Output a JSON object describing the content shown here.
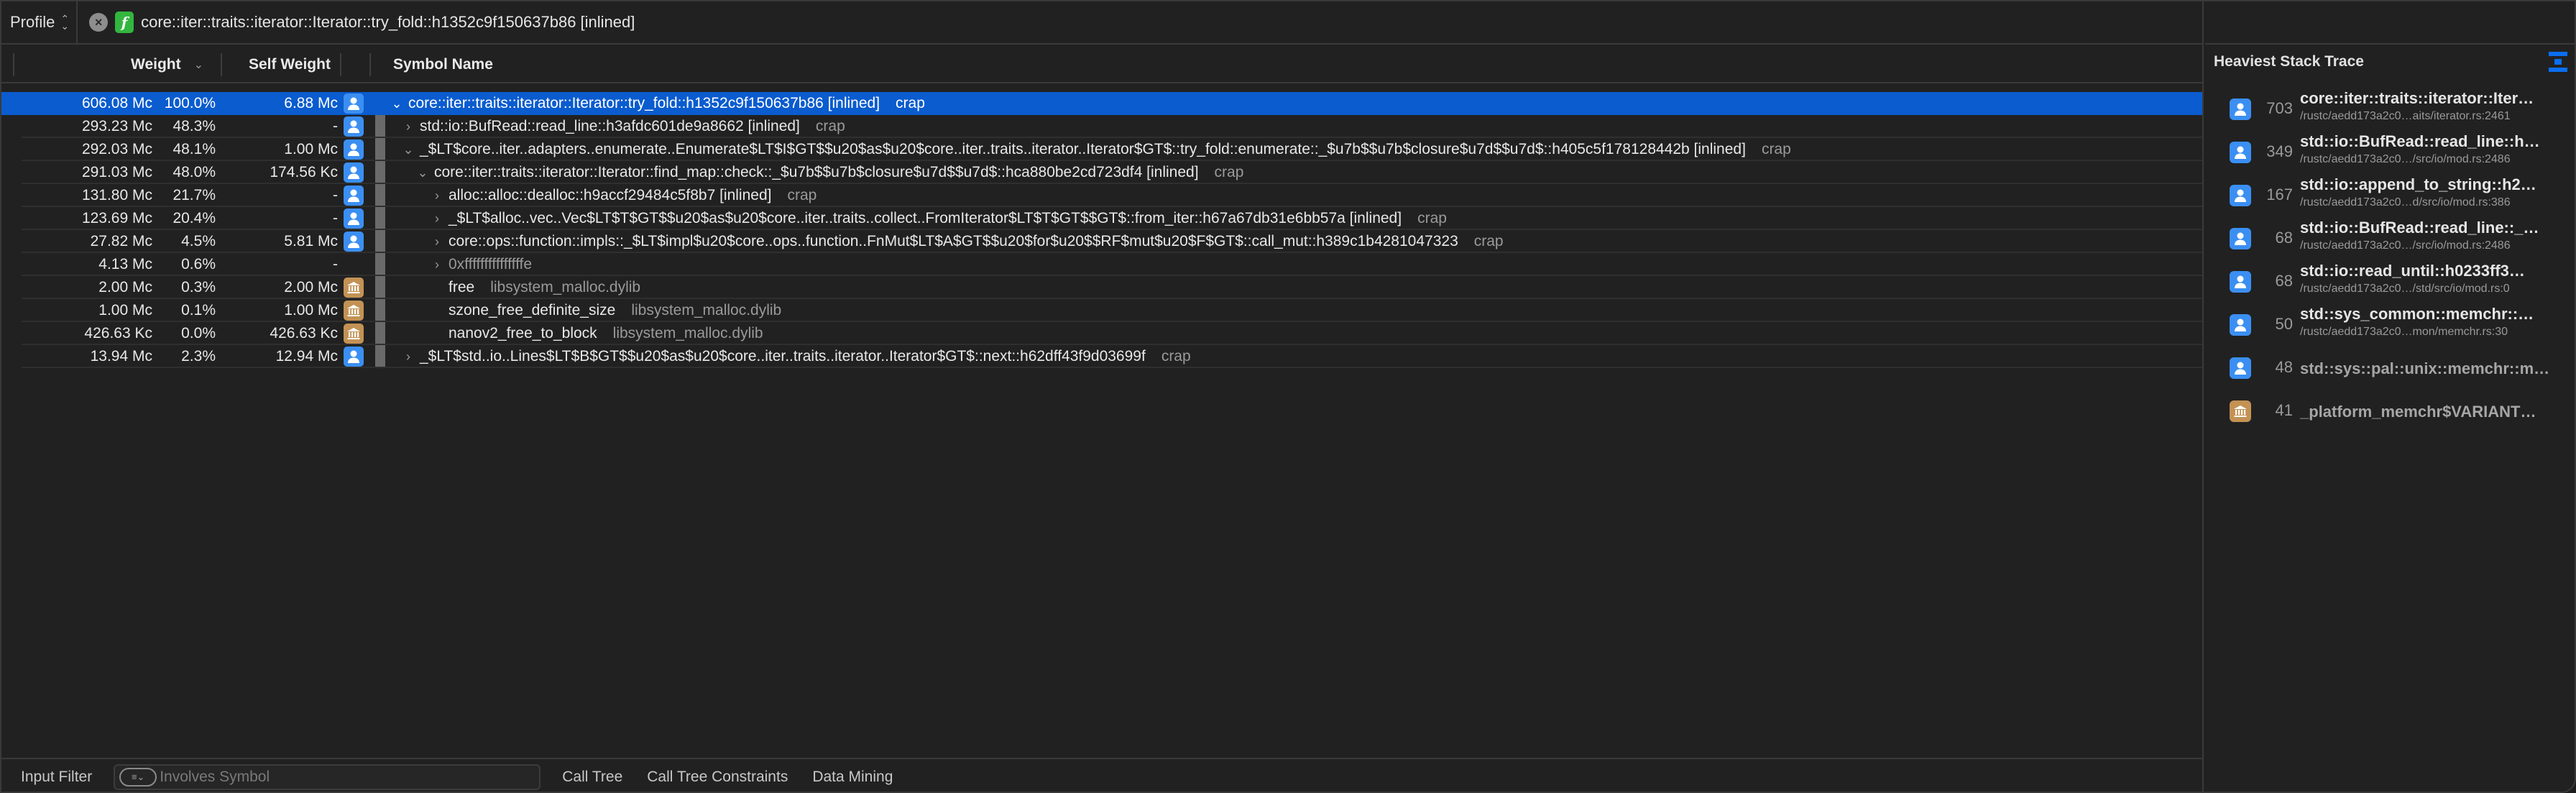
{
  "topbar": {
    "profile_label": "Profile",
    "clear_icon": "clear-circle-icon",
    "function_badge": "f",
    "path": "core::iter::traits::iterator::Iterator::try_fold::h1352c9f150637b86 [inlined]"
  },
  "columns": {
    "weight": "Weight",
    "self_weight": "Self Weight",
    "symbol_name": "Symbol Name",
    "sort_indicator": "chevron-down-icon"
  },
  "rows": [
    {
      "weight": "606.08 Mc",
      "pct": "100.0%",
      "self": "6.88 Mc",
      "icon": "user",
      "depth": 0,
      "disclosure": "open",
      "symbol": "core::iter::traits::iterator::Iterator::try_fold::h1352c9f150637b86 [inlined]",
      "lib": "crap",
      "selected": true
    },
    {
      "weight": "293.23 Mc",
      "pct": "48.3%",
      "self": "-",
      "icon": "user",
      "depth": 1,
      "disclosure": "closed",
      "symbol": "std::io::BufRead::read_line::h3afdc601de9a8662 [inlined]",
      "lib": "crap"
    },
    {
      "weight": "292.03 Mc",
      "pct": "48.1%",
      "self": "1.00 Mc",
      "icon": "user",
      "depth": 1,
      "disclosure": "open",
      "symbol": "_$LT$core..iter..adapters..enumerate..Enumerate$LT$I$GT$$u20$as$u20$core..iter..traits..iterator..Iterator$GT$::try_fold::enumerate::_$u7b$$u7b$closure$u7d$$u7d$::h405c5f178128442b [inlined]",
      "lib": "crap"
    },
    {
      "weight": "291.03 Mc",
      "pct": "48.0%",
      "self": "174.56 Kc",
      "icon": "user",
      "depth": 2,
      "disclosure": "open",
      "symbol": "core::iter::traits::iterator::Iterator::find_map::check::_$u7b$$u7b$closure$u7d$$u7d$::hca880be2cd723df4 [inlined]",
      "lib": "crap"
    },
    {
      "weight": "131.80 Mc",
      "pct": "21.7%",
      "self": "-",
      "icon": "user",
      "depth": 3,
      "disclosure": "closed",
      "symbol": "alloc::alloc::dealloc::h9accf29484c5f8b7 [inlined]",
      "lib": "crap"
    },
    {
      "weight": "123.69 Mc",
      "pct": "20.4%",
      "self": "-",
      "icon": "user",
      "depth": 3,
      "disclosure": "closed",
      "symbol": "_$LT$alloc..vec..Vec$LT$T$GT$$u20$as$u20$core..iter..traits..collect..FromIterator$LT$T$GT$$GT$::from_iter::h67a67db31e6bb57a [inlined]",
      "lib": "crap"
    },
    {
      "weight": "27.82 Mc",
      "pct": "4.5%",
      "self": "5.81 Mc",
      "icon": "user",
      "depth": 3,
      "disclosure": "closed",
      "symbol": "core::ops::function::impls::_$LT$impl$u20$core..ops..function..FnMut$LT$A$GT$$u20$for$u20$$RF$mut$u20$F$GT$::call_mut::h389c1b4281047323",
      "lib": "crap"
    },
    {
      "weight": "4.13 Mc",
      "pct": "0.6%",
      "self": "-",
      "icon": "none",
      "depth": 3,
      "disclosure": "closed",
      "symbol": "0xfffffffffffffffe",
      "lib": "",
      "dim": true
    },
    {
      "weight": "2.00 Mc",
      "pct": "0.3%",
      "self": "2.00 Mc",
      "icon": "lib",
      "depth": 3,
      "disclosure": "none",
      "symbol": "free",
      "lib": "libsystem_malloc.dylib"
    },
    {
      "weight": "1.00 Mc",
      "pct": "0.1%",
      "self": "1.00 Mc",
      "icon": "lib",
      "depth": 3,
      "disclosure": "none",
      "symbol": "szone_free_definite_size",
      "lib": "libsystem_malloc.dylib"
    },
    {
      "weight": "426.63 Kc",
      "pct": "0.0%",
      "self": "426.63 Kc",
      "icon": "lib",
      "depth": 3,
      "disclosure": "none",
      "symbol": "nanov2_free_to_block",
      "lib": "libsystem_malloc.dylib"
    },
    {
      "weight": "13.94 Mc",
      "pct": "2.3%",
      "self": "12.94 Mc",
      "icon": "user",
      "depth": 1,
      "disclosure": "closed",
      "symbol": "_$LT$std..io..Lines$LT$B$GT$$u20$as$u20$core..iter..traits..iterator..Iterator$GT$::next::h62dff43f9d03699f",
      "lib": "crap"
    }
  ],
  "bottombar": {
    "input_filter_label": "Input Filter",
    "filter_placeholder": "Involves Symbol",
    "tabs": [
      "Call Tree",
      "Call Tree Constraints",
      "Data Mining"
    ]
  },
  "side": {
    "title": "Heaviest Stack Trace",
    "toggle_icon": "focus-stack-icon",
    "items": [
      {
        "icon": "user",
        "count": "703",
        "name": "core::iter::traits::iterator::Iter…",
        "path": "/rustc/aedd173a2c0…aits/iterator.rs:2461"
      },
      {
        "icon": "user",
        "count": "349",
        "name": "std::io::BufRead::read_line::h…",
        "path": "/rustc/aedd173a2c0…/src/io/mod.rs:2486"
      },
      {
        "icon": "user",
        "count": "167",
        "name": "std::io::append_to_string::h2…",
        "path": "/rustc/aedd173a2c0…d/src/io/mod.rs:386"
      },
      {
        "icon": "user",
        "count": "68",
        "name": "std::io::BufRead::read_line::_…",
        "path": "/rustc/aedd173a2c0…/src/io/mod.rs:2486"
      },
      {
        "icon": "user",
        "count": "68",
        "name": "std::io::read_until::h0233ff3…",
        "path": "/rustc/aedd173a2c0…/std/src/io/mod.rs:0"
      },
      {
        "icon": "user",
        "count": "50",
        "name": "std::sys_common::memchr::…",
        "path": "/rustc/aedd173a2c0…mon/memchr.rs:30"
      },
      {
        "icon": "user",
        "count": "48",
        "name": "std::sys::pal::unix::memchr::m…",
        "path": ""
      },
      {
        "icon": "lib",
        "count": "41",
        "name": "_platform_memchr$VARIANT…",
        "path": ""
      }
    ]
  }
}
